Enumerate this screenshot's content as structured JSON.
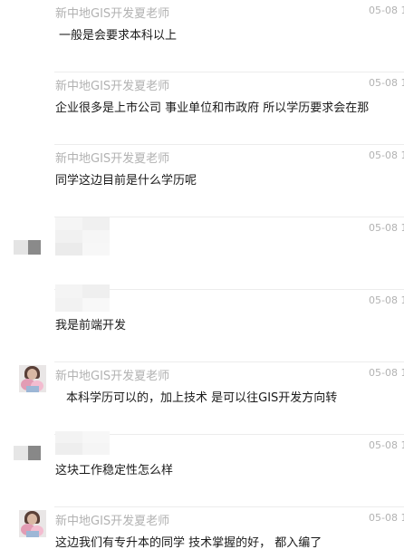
{
  "messages": [
    {
      "sender": "新中地GIS开发夏老师",
      "time": "05-08 1",
      "text": " 一般是会要求本科以上",
      "avatar": "none",
      "sender_blurred": false
    },
    {
      "sender": "新中地GIS开发夏老师",
      "time": "05-08 1",
      "text": "企业很多是上市公司  事业单位和市政府 所以学历要求会在那",
      "avatar": "none",
      "sender_blurred": false
    },
    {
      "sender": "新中地GIS开发夏老师",
      "time": "05-08 1",
      "text": "同学这边目前是什么学历呢",
      "avatar": "none",
      "sender_blurred": false
    },
    {
      "time": "05-08 1",
      "avatar": "blurred",
      "sender_blurred": true
    },
    {
      "time": "05-08 1",
      "text": "我是前端开发",
      "avatar": "none",
      "sender_blurred": true
    },
    {
      "sender": "新中地GIS开发夏老师",
      "time": "05-08 1",
      "text": "  本科学历可以的，加上技术 是可以往GIS开发方向转",
      "avatar": "photo",
      "sender_blurred": false
    },
    {
      "time": "05-08 1",
      "text": "这块工作稳定性怎么样",
      "avatar": "blurred",
      "sender_blurred": true
    },
    {
      "sender": "新中地GIS开发夏老师",
      "time": "05-08 1",
      "text": "这边我们有专升本的同学 技术掌握的好， 都入编了",
      "avatar": "photo",
      "sender_blurred": false
    }
  ]
}
